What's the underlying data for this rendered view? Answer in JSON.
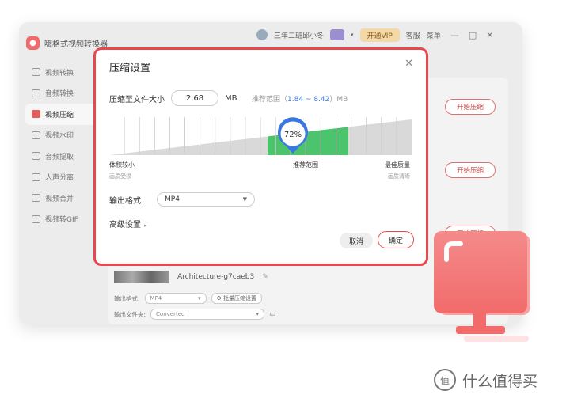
{
  "app": {
    "name": "嗨格式视频转换器",
    "user": "三年二班邱小冬",
    "vip_button": "开通VIP",
    "support": "客服",
    "menu": "菜单"
  },
  "sidebar": {
    "items": [
      {
        "label": "视频转换",
        "active": false
      },
      {
        "label": "音频转换",
        "active": false
      },
      {
        "label": "视频压缩",
        "active": true
      },
      {
        "label": "视频水印",
        "active": false
      },
      {
        "label": "音频提取",
        "active": false
      },
      {
        "label": "人声分离",
        "active": false
      },
      {
        "label": "视频合并",
        "active": false
      },
      {
        "label": "视频转GIF",
        "active": false
      }
    ]
  },
  "background": {
    "start_label": "开始压缩",
    "file_name": "Architecture-g7caeb3",
    "output_format_label": "输出格式:",
    "output_format_value": "MP4",
    "batch_button": "批量压缩设置",
    "output_folder_label": "输出文件夹:",
    "output_folder_value": "Converted"
  },
  "dialog": {
    "title": "压缩设置",
    "size_label": "压缩至文件大小",
    "size_value": "2.68",
    "size_unit": "MB",
    "range_prefix": "推荐范围（",
    "range_value": "1.84 ~ 8.42",
    "range_suffix": "）MB",
    "percent": 0.72,
    "percent_label": "72%",
    "left_label": "体积较小",
    "left_sub": "画质受损",
    "mid_label": "推荐范围",
    "right_label": "最佳质量",
    "right_sub": "画质清晰",
    "format_label": "输出格式：",
    "format_value": "MP4",
    "advanced_label": "高级设置",
    "cancel": "取消",
    "ok": "确定",
    "accent_color": "#e8474e",
    "range_color": "#4cc46e",
    "marker_color": "#3a77e0"
  },
  "watermark": {
    "text": "什么值得买",
    "logo": "值"
  }
}
